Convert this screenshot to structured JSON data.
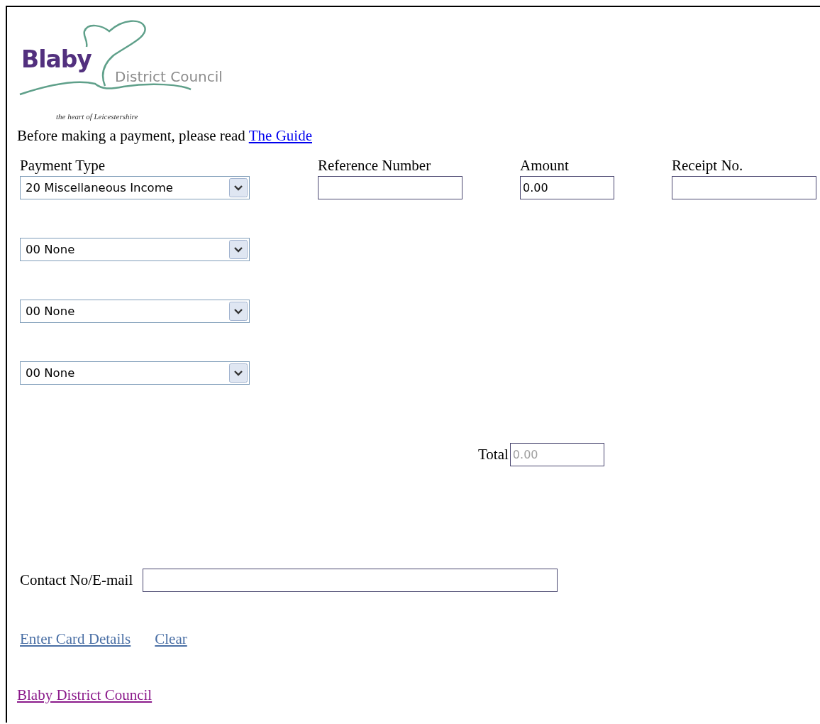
{
  "logo": {
    "name": "Blaby",
    "subtitle": "District Council",
    "tagline": "the heart of Leicestershire"
  },
  "intro": {
    "text": "Before making a payment, please read",
    "link": "The Guide"
  },
  "columns": [
    "Payment Type",
    "Reference Number",
    "Amount",
    "Receipt No."
  ],
  "first_row": {
    "payment_type": "20 Miscellaneous Income",
    "amount": "0.00"
  },
  "extra_payment_types": [
    "00 None",
    "00 None",
    "00 None"
  ],
  "total": {
    "label": "Total",
    "value": "0.00",
    "disabled": true
  },
  "contact": {
    "label": "Contact No/E-mail"
  },
  "actions": [
    "Enter Card Details",
    "Clear"
  ],
  "footer_link": "Blaby District Council"
}
